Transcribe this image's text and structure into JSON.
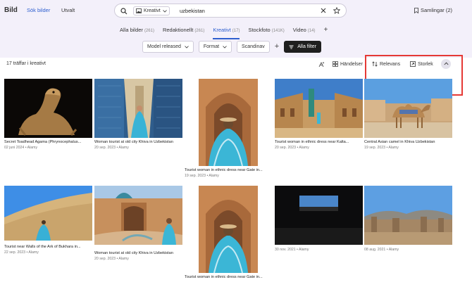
{
  "header": {
    "brand": "Bild",
    "nav": [
      {
        "label": "Sök bilder",
        "active": true
      },
      {
        "label": "Utvalt",
        "active": false
      }
    ],
    "search": {
      "content_type": "Kreativt",
      "query": "uzbekistan"
    },
    "collections_label": "Samlingar (2)"
  },
  "tabs": [
    {
      "label": "Alla bilder",
      "count": "(261)",
      "active": false
    },
    {
      "label": "Redaktionellt",
      "count": "(261)",
      "active": false
    },
    {
      "label": "Kreativt",
      "count": "(17)",
      "active": true
    },
    {
      "label": "Stockfoto",
      "count": "(141K)",
      "active": false
    },
    {
      "label": "Video",
      "count": "(14)",
      "active": false
    }
  ],
  "filters": {
    "model_released": "Model released",
    "format": "Format",
    "scandinavian": "Scandinav",
    "all_filters": "Alla filter"
  },
  "toolbar": {
    "results": "17 träffar i kreativt",
    "events": "Händelser",
    "relevance": "Relevans",
    "size": "Storlek",
    "size_slider_fraction": 0.38
  },
  "images": [
    {
      "caption": "Secret Toadhead Agama (Phrynocephalus...",
      "meta": "02 juni 2024 • Alamy",
      "scene": "lizard"
    },
    {
      "caption": "Woman tourist at old city Khiva in Uzbekistan",
      "meta": "20 sep. 2023 • Alamy",
      "scene": "tiles"
    },
    {
      "caption": "Tourist woman in ethnic dress near Gate in...",
      "meta": "19 sep. 2023 • Alamy",
      "scene": "gate"
    },
    {
      "caption": "Tourist woman in ethnic dress near Kalta...",
      "meta": "20 sep. 2023 • Alamy",
      "scene": "street"
    },
    {
      "caption": "Central Asian camel in Khiva Uzbekistan",
      "meta": "19 sep. 2023 • Alamy",
      "scene": "camel"
    },
    {
      "caption": "Tourist near Walls of the Ark of Bukhara in...",
      "meta": "22 sep. 2023 • Alamy",
      "scene": "wall"
    },
    {
      "caption": "Woman tourist at old city Khiva in Uzbekistan",
      "meta": "20 sep. 2023 • Alamy",
      "scene": "courtyard"
    },
    {
      "caption": "Tourist woman in ethnic dress near Gate in...",
      "meta": "",
      "scene": "gate"
    },
    {
      "caption": "",
      "meta": "30 nov. 2021 • Alamy",
      "scene": "dark"
    },
    {
      "caption": "",
      "meta": "08 aug. 2021 • Alamy",
      "scene": "ruins"
    }
  ],
  "colors": {
    "accent": "#2e5fcf",
    "header_bg": "#f3f0fa",
    "highlight": "#e53935"
  }
}
